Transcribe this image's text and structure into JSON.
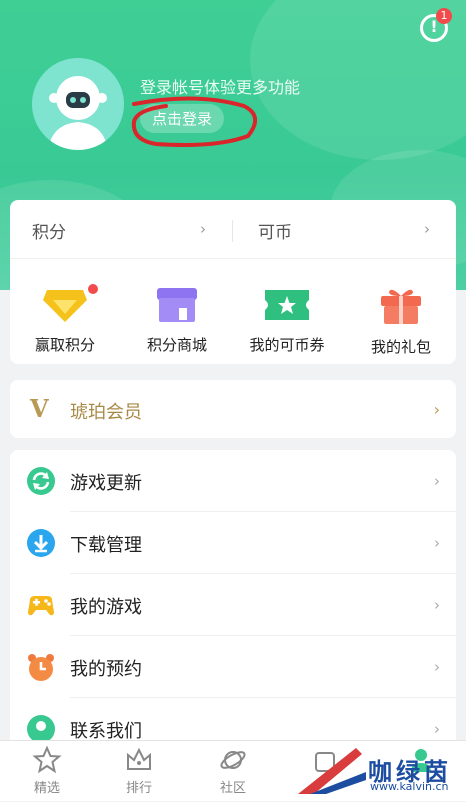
{
  "header": {
    "login_prompt": "登录帐号体验更多功能",
    "login_button": "点击登录",
    "message_badge": "1"
  },
  "points": {
    "left_label": "积分",
    "right_label": "可币"
  },
  "quick_actions": [
    {
      "label": "赢取积分",
      "icon": "diamond-icon"
    },
    {
      "label": "积分商城",
      "icon": "store-icon"
    },
    {
      "label": "我的可币券",
      "icon": "ticket-icon"
    },
    {
      "label": "我的礼包",
      "icon": "gift-icon"
    }
  ],
  "vip": {
    "badge": "V",
    "label": "琥珀会员"
  },
  "menu": [
    {
      "label": "游戏更新",
      "icon": "refresh-icon"
    },
    {
      "label": "下载管理",
      "icon": "download-icon"
    },
    {
      "label": "我的游戏",
      "icon": "gamepad-icon"
    },
    {
      "label": "我的预约",
      "icon": "alarm-clock-icon"
    },
    {
      "label": "联系我们",
      "icon": "contact-icon"
    }
  ],
  "tabs": [
    {
      "label": "精选",
      "icon": "star-icon"
    },
    {
      "label": "排行",
      "icon": "crown-icon"
    },
    {
      "label": "社区",
      "icon": "planet-icon"
    }
  ],
  "chevron": "›",
  "watermark": {
    "text": "咖绿茵",
    "url": "www.kalvin.cn"
  },
  "colors": {
    "header_green": "#3fcf95",
    "accent_red": "#f14b4b",
    "vip_gold": "#b89a55"
  }
}
